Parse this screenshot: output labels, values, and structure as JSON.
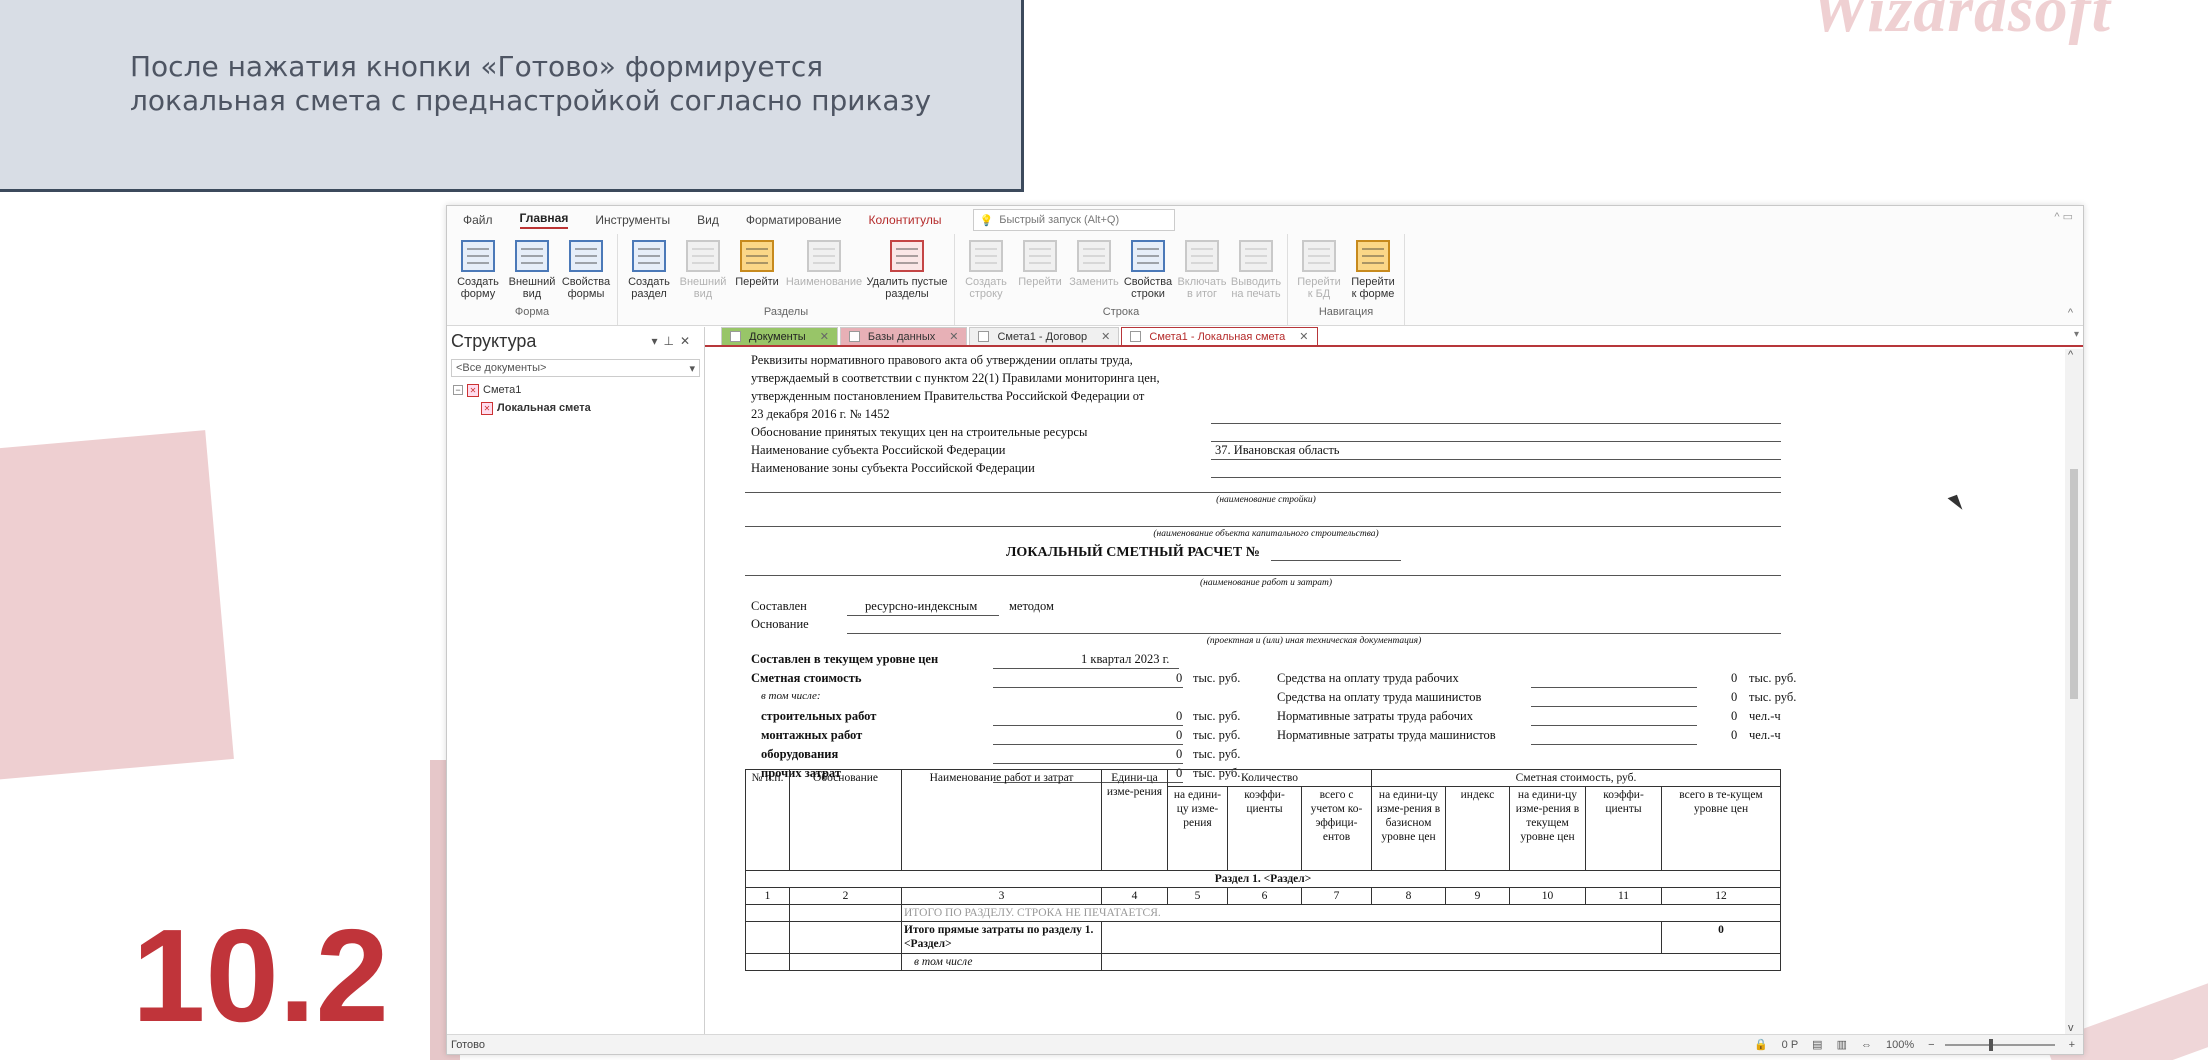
{
  "slide": {
    "caption_line1": "После нажатия кнопки «Готово»  формируется",
    "caption_line2": "локальная смета с преднастройкой согласно приказу",
    "logo": "Wizardsoft",
    "number": "10.2"
  },
  "menu": {
    "items": [
      "Файл",
      "Главная",
      "Инструменты",
      "Вид",
      "Форматирование"
    ],
    "context_item": "Колонтитулы",
    "quick_launch": "Быстрый запуск (Alt+Q)"
  },
  "ribbon": {
    "groups": [
      {
        "label": "Форма",
        "buttons": [
          {
            "l1": "Создать",
            "l2": "форму",
            "icon": "create-form-icon",
            "enabled": true
          },
          {
            "l1": "Внешний",
            "l2": "вид",
            "icon": "appearance-icon",
            "enabled": true
          },
          {
            "l1": "Свойства",
            "l2": "формы",
            "icon": "form-properties-icon",
            "enabled": true
          }
        ]
      },
      {
        "label": "Разделы",
        "buttons": [
          {
            "l1": "Создать",
            "l2": "раздел",
            "icon": "create-section-icon",
            "enabled": true
          },
          {
            "l1": "Внешний",
            "l2": "вид",
            "icon": "section-appearance-icon",
            "enabled": false
          },
          {
            "l1": "Перейти",
            "l2": "",
            "icon": "goto-icon",
            "enabled": true
          },
          {
            "l1": "Наименование",
            "l2": "",
            "icon": "name-icon",
            "enabled": false
          },
          {
            "l1": "Удалить пустые",
            "l2": "разделы",
            "icon": "delete-empty-sections-icon",
            "enabled": true
          }
        ]
      },
      {
        "label": "Строка",
        "buttons": [
          {
            "l1": "Создать",
            "l2": "строку",
            "icon": "create-row-icon",
            "enabled": false
          },
          {
            "l1": "Перейти",
            "l2": "",
            "icon": "goto-row-icon",
            "enabled": false
          },
          {
            "l1": "Заменить",
            "l2": "",
            "icon": "replace-icon",
            "enabled": false
          },
          {
            "l1": "Свойства",
            "l2": "строки",
            "icon": "row-properties-icon",
            "enabled": true
          },
          {
            "l1": "Включать",
            "l2": "в итог",
            "icon": "include-total-icon",
            "enabled": false
          },
          {
            "l1": "Выводить",
            "l2": "на печать",
            "icon": "print-output-icon",
            "enabled": false
          }
        ]
      },
      {
        "label": "Навигация",
        "buttons": [
          {
            "l1": "Перейти",
            "l2": "к БД",
            "icon": "goto-db-icon",
            "enabled": false
          },
          {
            "l1": "Перейти",
            "l2": "к форме",
            "icon": "goto-form-icon",
            "enabled": true
          }
        ]
      }
    ]
  },
  "structure": {
    "title": "Структура",
    "filter": "<Все документы>",
    "tree_root": "Смета1",
    "tree_child": "Локальная смета"
  },
  "tabs": [
    {
      "label": "Документы",
      "style": "t1"
    },
    {
      "label": "Базы данных",
      "style": "t2"
    },
    {
      "label": "Смета1 - Договор",
      "style": ""
    },
    {
      "label": "Смета1 - Локальная смета",
      "style": "active"
    }
  ],
  "document": {
    "req1": "Реквизиты нормативного правового акта об утверждении оплаты труда,",
    "req2": "утверждаемый в соответствии с пунктом 22(1) Правилами мониторинга цен,",
    "req3": "утвержденным постановлением Правительства Российской Федерации от",
    "req4": "23 декабря 2016 г. № 1452",
    "prices_basis": "Обоснование принятых текущих цен на строительные ресурсы",
    "subject_label": "Наименование субъекта Российской Федерации",
    "subject_value": "37. Ивановская область",
    "zone_label": "Наименование зоны субъекта Российской Федерации",
    "construction_hint": "(наименование стройки)",
    "object_hint": "(наименование объекта капитального строительства)",
    "doc_title": "ЛОКАЛЬНЫЙ СМЕТНЫЙ РАСЧЕТ №",
    "works_hint": "(наименование работ и затрат)",
    "composed_label": "Составлен",
    "composed_method": "ресурсно-индексным",
    "method_word": "методом",
    "basis_label": "Основание",
    "basis_hint": "(проектная и (или) иная техническая документация)",
    "price_level_label": "Составлен в текущем уровне цен",
    "price_level_value": "1 квартал 2023 г.",
    "cost_label": "Сметная стоимость",
    "including": "в том числе:",
    "unit_thousand": "тыс. руб.",
    "unit_manhours": "чел.-ч",
    "zero": "0",
    "costs": [
      "строительных работ",
      "монтажных работ",
      "оборудования",
      "прочих затрат"
    ],
    "right_items": [
      "Средства на оплату труда рабочих",
      "Средства на оплату труда машинистов",
      "Нормативные затраты труда рабочих",
      "Нормативные затраты труда машинистов"
    ]
  },
  "table": {
    "h_num": "№ п.п.",
    "h_basis": "Обоснование",
    "h_name": "Наименование работ и затрат",
    "h_unit": "Едини-ца изме-рения",
    "h_qty": "Количество",
    "h_qty_unit": "на едини-цу изме-рения",
    "h_qty_coef": "коэффи-циенты",
    "h_qty_total": "всего с учетом ко-эффици-ентов",
    "h_cost": "Сметная стоимость, руб.",
    "h_cost_base": "на едини-цу изме-рения в базисном уровне цен",
    "h_cost_index": "индекс",
    "h_cost_cur": "на едини-цу изме-рения в текущем уровне цен",
    "h_cost_coef": "коэффи-циенты",
    "h_cost_total": "всего в те-кущем уровне цен",
    "section": "Раздел 1. <Раздел>",
    "colnums": [
      "1",
      "2",
      "3",
      "4",
      "5",
      "6",
      "7",
      "8",
      "9",
      "10",
      "11",
      "12"
    ],
    "row_hidden": "ИТОГО ПО РАЗДЕЛУ. СТРОКА НЕ ПЕЧАТАЕТСЯ.",
    "row_total": "Итого прямые затраты по разделу 1. <Раздел>",
    "row_total_value": "0",
    "row_including": "в том числе"
  },
  "status": {
    "left": "Готово",
    "money": "0 Р",
    "zoom": "100%"
  }
}
